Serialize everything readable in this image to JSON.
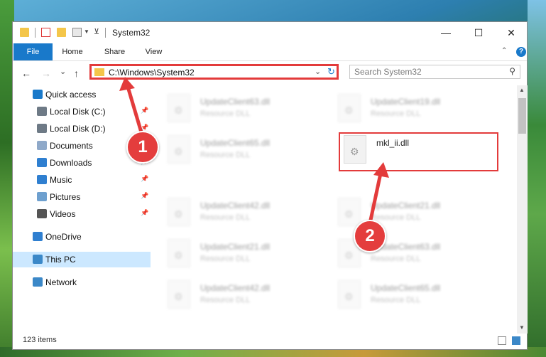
{
  "window": {
    "title": "System32",
    "controls": {
      "minimize": "—",
      "maximize": "☐",
      "close": "✕"
    }
  },
  "ribbon": {
    "tabs": [
      "File",
      "Home",
      "Share",
      "View"
    ],
    "help": "?"
  },
  "navigation": {
    "back": "←",
    "forward": "→",
    "recent": "⌄",
    "up": "↑",
    "address": "C:\\Windows\\System32",
    "search_placeholder": "Search System32"
  },
  "sidebar": {
    "items": [
      {
        "label": "Quick access",
        "icon": "star-icon",
        "color": "#1979ca"
      },
      {
        "label": "Local Disk (C:)",
        "icon": "drive-icon",
        "color": "#6e7a86",
        "pinned": true
      },
      {
        "label": "Local Disk (D:)",
        "icon": "drive-icon",
        "color": "#6e7a86",
        "pinned": true
      },
      {
        "label": "Documents",
        "icon": "documents-icon",
        "color": "#8fa9c9",
        "pinned": true
      },
      {
        "label": "Downloads",
        "icon": "downloads-icon",
        "color": "#2f7fd0",
        "pinned": true
      },
      {
        "label": "Music",
        "icon": "music-icon",
        "color": "#2f7fd0",
        "pinned": true
      },
      {
        "label": "Pictures",
        "icon": "pictures-icon",
        "color": "#6ea0cf",
        "pinned": true
      },
      {
        "label": "Videos",
        "icon": "videos-icon",
        "color": "#555555",
        "pinned": true
      },
      {
        "label": "OneDrive",
        "icon": "cloud-icon",
        "color": "#2f7fd0"
      },
      {
        "label": "This PC",
        "icon": "computer-icon",
        "color": "#3b88c8",
        "selected": true
      },
      {
        "label": "Network",
        "icon": "network-icon",
        "color": "#3b88c8"
      }
    ]
  },
  "files": [
    {
      "name": "UpdateClient63.dll",
      "type": "Resource DLL",
      "blurred": true
    },
    {
      "name": "UpdateClient19.dll",
      "type": "Resource DLL",
      "blurred": true
    },
    {
      "name": "UpdateClient65.dll",
      "type": "Resource DLL",
      "blurred": true
    },
    {
      "name": "mkl_ii.dll",
      "type": "",
      "blurred": false,
      "highlighted": true
    },
    {
      "name": "UpdateClient42.dll",
      "type": "Resource DLL",
      "blurred": true
    },
    {
      "name": "UpdateClient21.dll",
      "type": "Resource DLL",
      "blurred": true
    },
    {
      "name": "UpdateClient21.dll",
      "type": "Resource DLL",
      "blurred": true
    },
    {
      "name": "UpdateClient63.dll",
      "type": "Resource DLL",
      "blurred": true
    },
    {
      "name": "UpdateClient42.dll",
      "type": "Resource DLL",
      "blurred": true
    },
    {
      "name": "UpdateClient65.dll",
      "type": "Resource DLL",
      "blurred": true
    }
  ],
  "status": {
    "item_count": "123 items"
  },
  "annotations": {
    "marker_1": "1",
    "marker_2": "2",
    "color": "#e33b3b"
  }
}
